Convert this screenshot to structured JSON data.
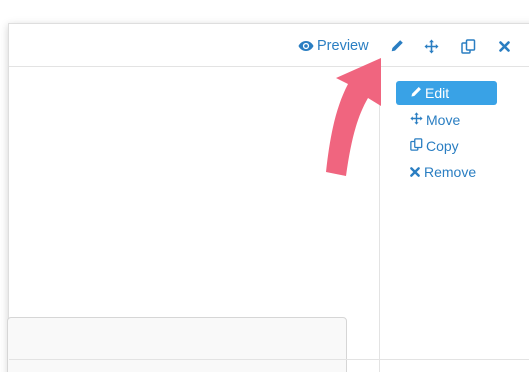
{
  "toolbar": {
    "preview_label": "Preview",
    "icons": [
      "eye-icon",
      "pencil-icon",
      "move-icon",
      "copy-icon",
      "close-icon"
    ]
  },
  "side_menu": {
    "items": [
      {
        "label": "Edit",
        "icon": "pencil-icon",
        "active": true
      },
      {
        "label": "Move",
        "icon": "move-icon",
        "active": false
      },
      {
        "label": "Copy",
        "icon": "copy-icon",
        "active": false
      },
      {
        "label": "Remove",
        "icon": "close-icon",
        "active": false
      }
    ]
  },
  "colors": {
    "link": "#2a7ec2",
    "active_bg": "#39a2e6",
    "annotation_arrow": "#f0657f"
  }
}
